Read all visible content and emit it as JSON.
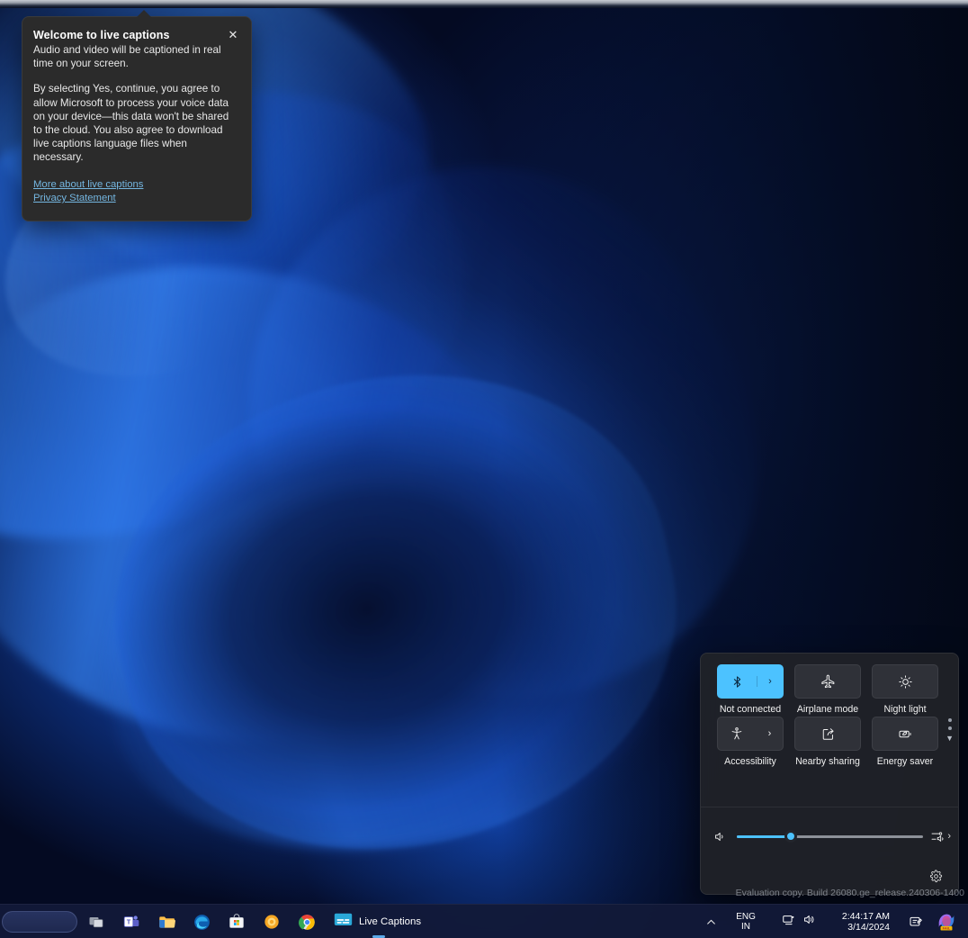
{
  "desktop": {
    "watermark": "Evaluation copy. Build 26080.ge_release.240306-1400"
  },
  "captions_dialog": {
    "title": "Welcome to live captions",
    "paragraph1": "Audio and video will be captioned in real time on your screen.",
    "paragraph2": "By selecting Yes, continue, you agree to allow Microsoft to process your voice data on your device—this data won't be shared to the cloud. You also agree to download live captions language files when necessary.",
    "close_label": "✕",
    "links": [
      {
        "label": "More about live captions"
      },
      {
        "label": "Privacy Statement"
      }
    ],
    "link_color": "#74b6e0"
  },
  "quick_settings": {
    "accent_color": "#4cc2ff",
    "tiles": [
      {
        "label": "Not connected",
        "icon": "bluetooth-icon",
        "active": true,
        "has_chevron": true
      },
      {
        "label": "Airplane mode",
        "icon": "airplane-icon",
        "active": false,
        "has_chevron": false
      },
      {
        "label": "Night light",
        "icon": "night-light-icon",
        "active": false,
        "has_chevron": false
      },
      {
        "label": "Accessibility",
        "icon": "accessibility-icon",
        "active": false,
        "has_chevron": true
      },
      {
        "label": "Nearby sharing",
        "icon": "nearby-sharing-icon",
        "active": false,
        "has_chevron": false
      },
      {
        "label": "Energy saver",
        "icon": "energy-saver-icon",
        "active": false,
        "has_chevron": false
      }
    ],
    "volume": {
      "icon": "speaker-icon",
      "value": 29,
      "output_icon": "audio-mixer-icon",
      "chevron": "›"
    },
    "pager": {
      "dots": 2,
      "chevron": "▼"
    },
    "settings_icon": "gear-icon"
  },
  "taskbar": {
    "search_placeholder": "",
    "items": [
      {
        "name": "task-view",
        "label": "Task view"
      },
      {
        "name": "teams",
        "label": "Microsoft Teams"
      },
      {
        "name": "file-explorer",
        "label": "File Explorer"
      },
      {
        "name": "edge",
        "label": "Microsoft Edge"
      },
      {
        "name": "microsoft-store",
        "label": "Microsoft Store"
      },
      {
        "name": "browser-orange",
        "label": "Browser"
      },
      {
        "name": "chrome",
        "label": "Google Chrome"
      }
    ],
    "active_task": {
      "label": "Live Captions",
      "icon": "live-captions-icon"
    },
    "tray": {
      "overflow_chevron": "∧",
      "language": {
        "line1": "ENG",
        "line2": "IN"
      },
      "network_icon": "network-icon",
      "volume_icon": "volume-icon",
      "clock": {
        "time": "2:44:17 AM",
        "date": "3/14/2024"
      },
      "notification_icon": "notification-bell-icon",
      "app_icon": "copilot-icon"
    }
  }
}
